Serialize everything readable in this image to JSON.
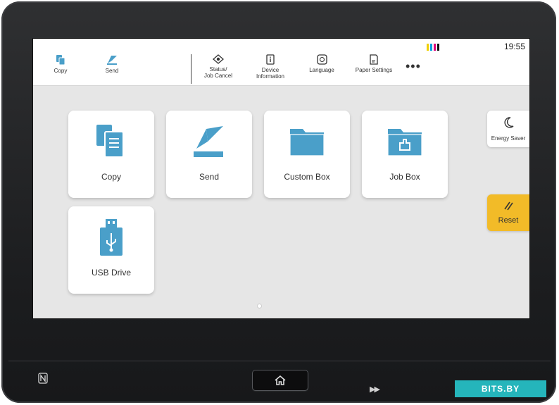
{
  "topbar": {
    "left_items": [
      {
        "label": "Copy",
        "icon": "copy-icon"
      },
      {
        "label": "Send",
        "icon": "send-icon"
      }
    ],
    "right_items": [
      {
        "label": "Status/\nJob Cancel",
        "icon": "eye-icon"
      },
      {
        "label": "Device\nInformation",
        "icon": "info-icon"
      },
      {
        "label": "Language",
        "icon": "language-icon"
      },
      {
        "label": "Paper Settings",
        "icon": "paper-icon"
      }
    ],
    "more": "•••",
    "time": "19:55",
    "toner_colors": [
      "#f0d000",
      "#00a0e0",
      "#e0007a",
      "#111111"
    ]
  },
  "tiles": [
    {
      "label": "Copy",
      "icon": "copy-icon"
    },
    {
      "label": "Send",
      "icon": "send-icon"
    },
    {
      "label": "Custom Box",
      "icon": "folder-icon"
    },
    {
      "label": "Job Box",
      "icon": "job-box-icon"
    },
    {
      "label": "USB Drive",
      "icon": "usb-drive-icon"
    }
  ],
  "side": {
    "energy_saver": "Energy Saver",
    "reset": "Reset"
  },
  "watermark": "BITS.BY",
  "colors": {
    "accent": "#4a9fc9",
    "reset": "#f2bb28"
  }
}
